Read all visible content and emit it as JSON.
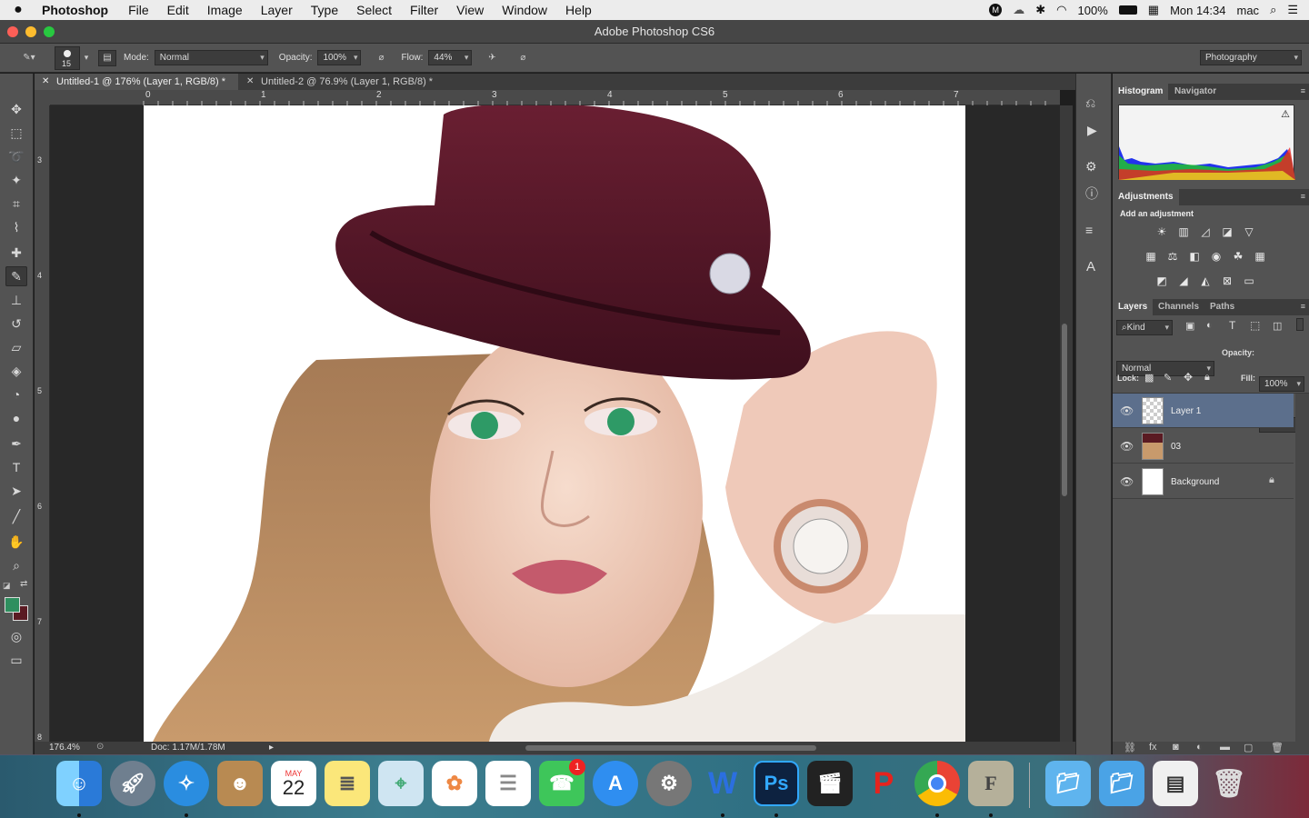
{
  "menubar": {
    "app_name": "Photoshop",
    "items": [
      "File",
      "Edit",
      "Image",
      "Layer",
      "Type",
      "Select",
      "Filter",
      "View",
      "Window",
      "Help"
    ],
    "battery": "100%",
    "clock": "Mon 14:34",
    "user": "mac"
  },
  "window": {
    "title": "Adobe Photoshop CS6"
  },
  "options": {
    "brush_size": "15",
    "mode_label": "Mode:",
    "mode_value": "Normal",
    "opacity_label": "Opacity:",
    "opacity_value": "100%",
    "flow_label": "Flow:",
    "flow_value": "44%",
    "workspace": "Photography"
  },
  "tabs": [
    {
      "label": "Untitled-1 @ 176% (Layer 1, RGB/8) *",
      "active": true
    },
    {
      "label": "Untitled-2 @ 76.9% (Layer 1, RGB/8) *",
      "active": false
    }
  ],
  "ruler": {
    "top": [
      "0",
      "1",
      "2",
      "3",
      "4",
      "5",
      "6",
      "7"
    ],
    "left": [
      "3",
      "4",
      "5",
      "6",
      "7",
      "8"
    ]
  },
  "status": {
    "zoom": "176.4%",
    "doc": "Doc: 1.17M/1.78M"
  },
  "colors": {
    "foreground": "#2f8f5f",
    "background": "#5a1a22",
    "selected_layer": "#5c6f8c"
  },
  "panels": {
    "histogram_tabs": [
      "Histogram",
      "Navigator"
    ],
    "adjustments_title": "Adjustments",
    "adjustments_subtitle": "Add an adjustment",
    "layers_tabs": [
      "Layers",
      "Channels",
      "Paths"
    ],
    "kind_label": "Kind",
    "blend_mode": "Normal",
    "opacity_label": "Opacity:",
    "opacity_value": "100%",
    "lock_label": "Lock:",
    "fill_label": "Fill:",
    "fill_value": "100%",
    "layers": [
      {
        "name": "Layer 1",
        "selected": true
      },
      {
        "name": "03",
        "selected": false
      },
      {
        "name": "Background",
        "selected": false,
        "locked": true
      }
    ]
  },
  "dock": {
    "calendar_month": "MAY",
    "calendar_day": "22",
    "facetime_badge": "1",
    "word_letter": "W",
    "ps_letters": "Ps",
    "font_letter": "F"
  }
}
